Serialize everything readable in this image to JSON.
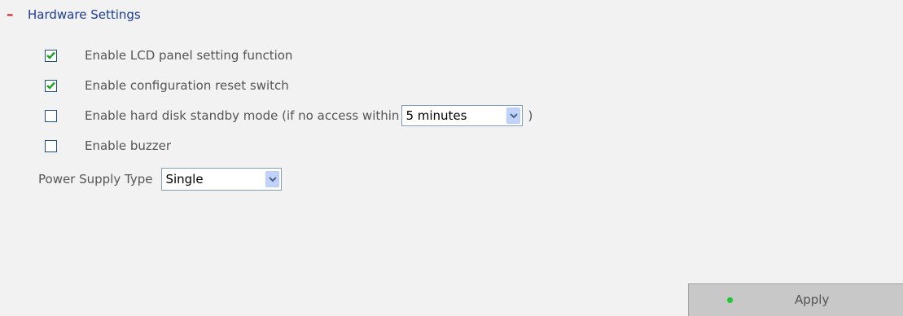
{
  "section": {
    "title": "Hardware Settings",
    "collapse_icon": "minus-icon"
  },
  "options": [
    {
      "label": "Enable LCD panel setting function",
      "checked": true
    },
    {
      "label": "Enable configuration reset switch",
      "checked": true
    },
    {
      "label": "Enable hard disk standby mode (if no access within",
      "checked": false
    },
    {
      "label": "Enable buzzer",
      "checked": false
    }
  ],
  "standby": {
    "selected": "5 minutes",
    "close_paren": ")"
  },
  "power_supply": {
    "label": "Power Supply Type",
    "selected": "Single"
  },
  "apply": {
    "label": "Apply",
    "icon": "green-dot-icon"
  },
  "colors": {
    "panel_bg": "#f2f2f2",
    "title_blue": "#1d3b96",
    "collapse_red": "#e02020",
    "check_green": "#21a121",
    "apply_dot_green": "#22c833"
  }
}
